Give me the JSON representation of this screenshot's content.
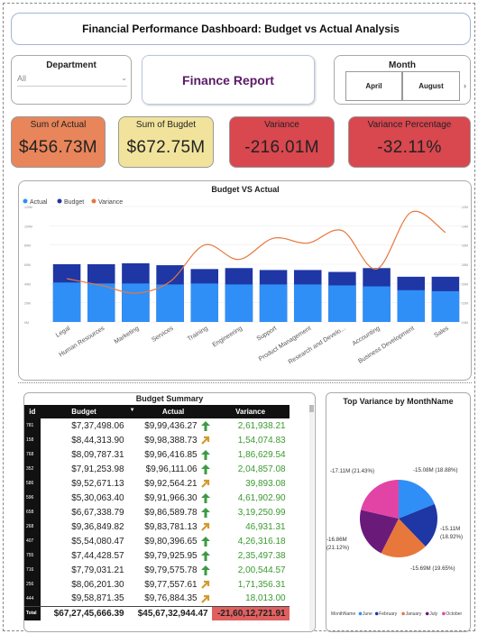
{
  "header": {
    "title": "Financial Performance Dashboard: Budget vs Actual Analysis"
  },
  "department": {
    "label": "Department",
    "value": "All"
  },
  "report": {
    "label": "Finance Report"
  },
  "month": {
    "label": "Month",
    "options": [
      "April",
      "August"
    ]
  },
  "kpis": [
    {
      "label": "Sum of Actual",
      "value": "$456.73M",
      "color": "#e9855a"
    },
    {
      "label": "Sum of Bugdet",
      "value": "$672.75M",
      "color": "#f1e39b"
    },
    {
      "label": "Variance",
      "value": "-216.01M",
      "color": "#d9474f"
    },
    {
      "label": "Variance Percentage",
      "value": "-32.11%",
      "color": "#d9474f"
    }
  ],
  "chart_data": [
    {
      "type": "bar",
      "title": "Budget VS Actual",
      "legend": [
        "Actual",
        "Budget",
        "Variance"
      ],
      "legend_position": "top-left",
      "categories": [
        "Legal",
        "Human Resources",
        "Marketing",
        "Services",
        "Training",
        "Engineering",
        "Support",
        "Product Management",
        "Research and Develo...",
        "Accounting",
        "Business Development",
        "Sales"
      ],
      "series": [
        {
          "name": "Actual",
          "values": [
            41,
            40,
            40,
            39,
            40,
            39,
            39,
            39,
            38,
            37,
            33,
            32
          ],
          "color": "#2f8ff7"
        },
        {
          "name": "Budget",
          "values": [
            60,
            60,
            61,
            59,
            55,
            56,
            54,
            54,
            52,
            56,
            47,
            47
          ],
          "color": "#1f36a5"
        },
        {
          "name": "Variance",
          "values": [
            -19.5,
            -20.2,
            -21.0,
            -19.8,
            -16.0,
            -17.5,
            -15.3,
            -15.8,
            -14.5,
            -18.5,
            -12.6,
            -14.7
          ],
          "color": "#e8773c"
        }
      ],
      "y_tick_labels": [
        "0M",
        "20M",
        "40M",
        "60M",
        "80M",
        "100M",
        "120M"
      ],
      "y2_tick_labels": [
        "-24M",
        "-22M",
        "-20M",
        "-18M",
        "-16M",
        "-14M",
        "-12M"
      ],
      "ylim": [
        0,
        120
      ],
      "y2lim": [
        -24,
        -12
      ]
    },
    {
      "type": "pie",
      "title": "Top Variance by MonthName",
      "legend_title": "MonthName",
      "legend_position": "bottom",
      "categories": [
        "June",
        "February",
        "January",
        "July",
        "October"
      ],
      "values": [
        15.08,
        15.11,
        15.69,
        16.86,
        17.11
      ],
      "colors": [
        "#2f8ff7",
        "#1f36a5",
        "#e8773c",
        "#6a1b7a",
        "#e244a6"
      ],
      "data_labels": [
        "-15.08M (18.88%)",
        "-15.11M (18.92%)",
        "-15.69M (19.65%)",
        "-16.86M (21.12%)",
        "-17.11M (21.43%)"
      ]
    }
  ],
  "budget_summary": {
    "title": "Budget Summary",
    "columns": [
      "id",
      "Budget",
      "Actual",
      "Variance"
    ],
    "rows": [
      {
        "id": "781",
        "budget": "$7,37,498.06",
        "actual": "$9,99,436.27",
        "variance": "2,61,938.21",
        "trend": "up"
      },
      {
        "id": "158",
        "budget": "$8,44,313.90",
        "actual": "$9,98,388.73",
        "variance": "1,54,074.83",
        "trend": "diag"
      },
      {
        "id": "768",
        "budget": "$8,09,787.31",
        "actual": "$9,96,416.85",
        "variance": "1,86,629.54",
        "trend": "up"
      },
      {
        "id": "352",
        "budget": "$7,91,253.98",
        "actual": "$9,96,111.06",
        "variance": "2,04,857.08",
        "trend": "up"
      },
      {
        "id": "586",
        "budget": "$9,52,671.13",
        "actual": "$9,92,564.21",
        "variance": "39,893.08",
        "trend": "diag"
      },
      {
        "id": "596",
        "budget": "$5,30,063.40",
        "actual": "$9,91,966.30",
        "variance": "4,61,902.90",
        "trend": "up"
      },
      {
        "id": "658",
        "budget": "$6,67,338.79",
        "actual": "$9,86,589.78",
        "variance": "3,19,250.99",
        "trend": "up"
      },
      {
        "id": "268",
        "budget": "$9,36,849.82",
        "actual": "$9,83,781.13",
        "variance": "46,931.31",
        "trend": "diag"
      },
      {
        "id": "407",
        "budget": "$5,54,080.47",
        "actual": "$9,80,396.65",
        "variance": "4,26,316.18",
        "trend": "up"
      },
      {
        "id": "755",
        "budget": "$7,44,428.57",
        "actual": "$9,79,925.95",
        "variance": "2,35,497.38",
        "trend": "up"
      },
      {
        "id": "716",
        "budget": "$7,79,031.21",
        "actual": "$9,79,575.78",
        "variance": "2,00,544.57",
        "trend": "up"
      },
      {
        "id": "256",
        "budget": "$8,06,201.30",
        "actual": "$9,77,557.61",
        "variance": "1,71,356.31",
        "trend": "diag"
      },
      {
        "id": "444",
        "budget": "$9,58,871.35",
        "actual": "$9,76,884.35",
        "variance": "18,013.00",
        "trend": "diag"
      }
    ],
    "total": {
      "label": "Total",
      "budget": "$67,27,45,666.39",
      "actual": "$45,67,32,944.47",
      "variance": "-21,60,12,721.91"
    }
  }
}
